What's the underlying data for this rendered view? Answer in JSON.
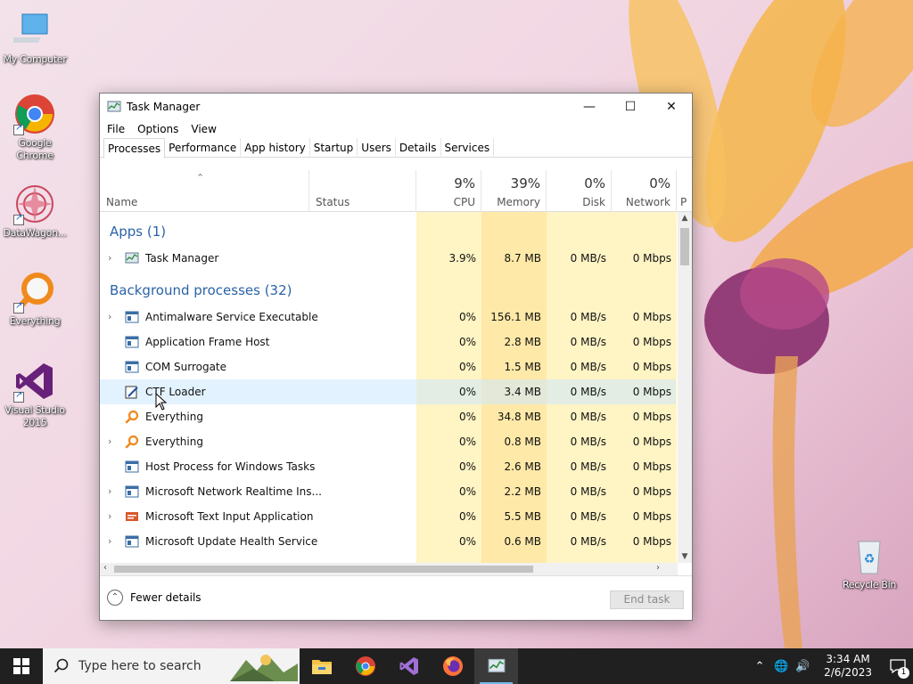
{
  "desktop": {
    "icons": [
      {
        "label": "My Computer"
      },
      {
        "label": "Google Chrome"
      },
      {
        "label": "DataWagon..."
      },
      {
        "label": "Everything"
      },
      {
        "label": "Visual Studio 2015"
      },
      {
        "label": "Recycle Bin"
      }
    ]
  },
  "window": {
    "title": "Task Manager",
    "menu": [
      "File",
      "Options",
      "View"
    ],
    "tabs": [
      "Processes",
      "Performance",
      "App history",
      "Startup",
      "Users",
      "Details",
      "Services"
    ],
    "active_tab": "Processes",
    "columns": {
      "name": "Name",
      "status": "Status",
      "cpu": {
        "pct": "9%",
        "label": "CPU"
      },
      "memory": {
        "pct": "39%",
        "label": "Memory"
      },
      "disk": {
        "pct": "0%",
        "label": "Disk"
      },
      "network": {
        "pct": "0%",
        "label": "Network"
      },
      "power": "P"
    },
    "groups": {
      "apps": "Apps (1)",
      "background": "Background processes (32)"
    },
    "apps": [
      {
        "name": "Task Manager",
        "cpu": "3.9%",
        "memory": "8.7 MB",
        "disk": "0 MB/s",
        "network": "0 Mbps"
      }
    ],
    "background": [
      {
        "name": "Antimalware Service Executable",
        "cpu": "0%",
        "memory": "156.1 MB",
        "disk": "0 MB/s",
        "network": "0 Mbps"
      },
      {
        "name": "Application Frame Host",
        "cpu": "0%",
        "memory": "2.8 MB",
        "disk": "0 MB/s",
        "network": "0 Mbps"
      },
      {
        "name": "COM Surrogate",
        "cpu": "0%",
        "memory": "1.5 MB",
        "disk": "0 MB/s",
        "network": "0 Mbps"
      },
      {
        "name": "CTF Loader",
        "cpu": "0%",
        "memory": "3.4 MB",
        "disk": "0 MB/s",
        "network": "0 Mbps"
      },
      {
        "name": "Everything",
        "cpu": "0%",
        "memory": "34.8 MB",
        "disk": "0 MB/s",
        "network": "0 Mbps"
      },
      {
        "name": "Everything",
        "cpu": "0%",
        "memory": "0.8 MB",
        "disk": "0 MB/s",
        "network": "0 Mbps"
      },
      {
        "name": "Host Process for Windows Tasks",
        "cpu": "0%",
        "memory": "2.6 MB",
        "disk": "0 MB/s",
        "network": "0 Mbps"
      },
      {
        "name": "Microsoft Network Realtime Ins...",
        "cpu": "0%",
        "memory": "2.2 MB",
        "disk": "0 MB/s",
        "network": "0 Mbps"
      },
      {
        "name": "Microsoft Text Input Application",
        "cpu": "0%",
        "memory": "5.5 MB",
        "disk": "0 MB/s",
        "network": "0 Mbps"
      },
      {
        "name": "Microsoft Update Health Service",
        "cpu": "0%",
        "memory": "0.6 MB",
        "disk": "0 MB/s",
        "network": "0 Mbps"
      }
    ],
    "footer": {
      "fewer_details": "Fewer details",
      "end_task": "End task"
    }
  },
  "taskbar": {
    "search_placeholder": "Type here to search",
    "time": "3:34 AM",
    "date": "2/6/2023",
    "notification_count": "1"
  },
  "colors": {
    "accent": "#2b63a8",
    "cpu_shade": "#fff4c4",
    "mem_shade": "#ffe9a8",
    "taskbar": "#202020"
  }
}
